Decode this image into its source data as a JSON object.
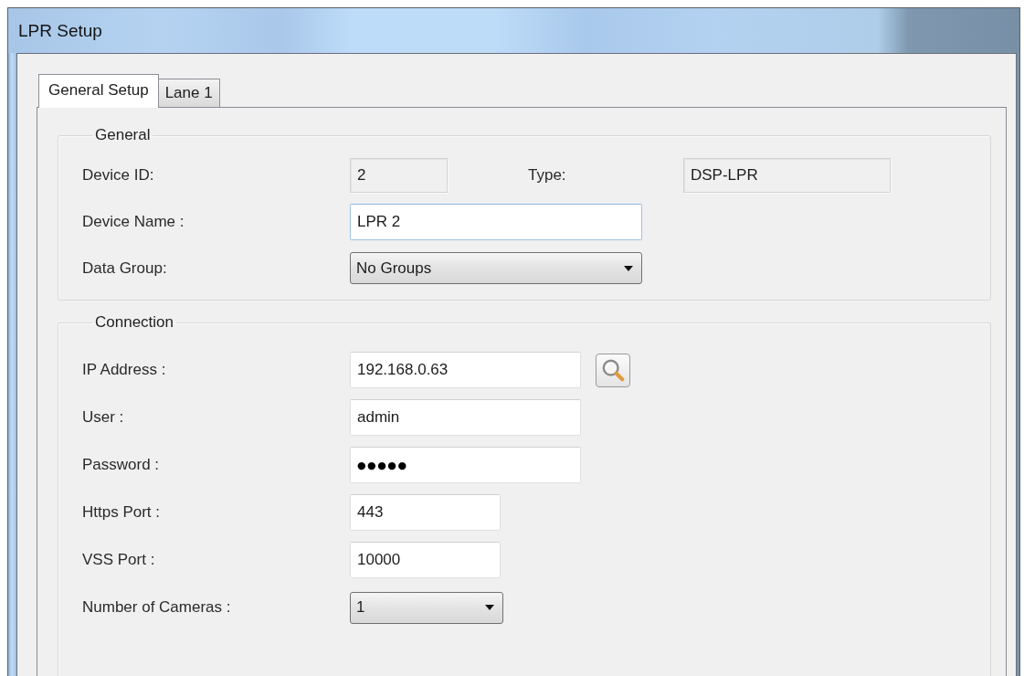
{
  "window": {
    "title": "LPR Setup"
  },
  "tabs": [
    {
      "label": "General Setup",
      "selected": true
    },
    {
      "label": "Lane 1",
      "selected": false
    }
  ],
  "groups": [
    {
      "title": "General",
      "rows": [
        {
          "fields": [
            {
              "label": "Device ID:",
              "kind": "readonly",
              "value": "2"
            },
            {
              "label": "Type:",
              "kind": "readonly",
              "value": "DSP-LPR"
            }
          ]
        },
        {
          "fields": [
            {
              "label": "Device Name :",
              "kind": "text",
              "value": "LPR 2",
              "focused": true
            }
          ]
        },
        {
          "fields": [
            {
              "label": "Data Group:",
              "kind": "dropdown",
              "value": "No Groups"
            }
          ]
        }
      ]
    },
    {
      "title": "Connection",
      "rows": [
        {
          "fields": [
            {
              "label": "IP Address :",
              "kind": "text",
              "value": "192.168.0.63",
              "focused": false,
              "lookup_button": true
            }
          ]
        },
        {
          "fields": [
            {
              "label": "User :",
              "kind": "text",
              "value": "admin",
              "focused": false
            }
          ]
        },
        {
          "fields": [
            {
              "label": "Password :",
              "kind": "password",
              "value": "●●●●●",
              "focused": false
            }
          ]
        },
        {
          "fields": [
            {
              "label": "Https Port :",
              "kind": "text",
              "value": "443",
              "focused": false
            }
          ]
        },
        {
          "fields": [
            {
              "label": "VSS Port :",
              "kind": "text",
              "value": "10000",
              "focused": false
            }
          ]
        },
        {
          "fields": [
            {
              "label": "Number of Cameras :",
              "kind": "dropdown",
              "value": "1"
            }
          ]
        }
      ]
    }
  ]
}
